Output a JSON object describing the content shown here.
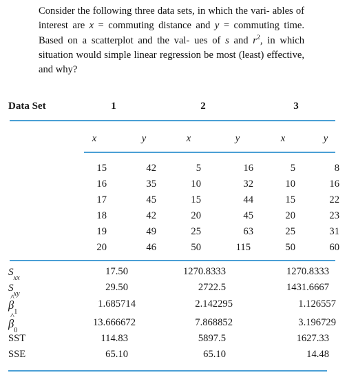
{
  "intro": {
    "line1": "Consider the following three data sets, in which the vari-",
    "line2_a": "ables  of  interest  are  ",
    "line2_x": "x",
    "line2_eq": " = commuting distance  and",
    "line3_y": "y",
    "line3_b": " = commuting time. Based on a scatterplot and the val-",
    "line4_a": "ues of ",
    "line4_s": "s",
    "line4_b": " and ",
    "line4_r": "r",
    "line4_sup": "2",
    "line4_c": ", in which situation would simple linear",
    "line5": "regression be most (least) effective, and why?",
    "full_text": "Consider the following three data sets, in which the variables of interest are x = commuting distance and y = commuting time. Based on a scatterplot and the values of s and r2, in which situation would simple linear regression be most (least) effective, and why?"
  },
  "table": {
    "corner_label": "Data Set",
    "dataset_headers": [
      "1",
      "2",
      "3"
    ],
    "column_headers": [
      "x",
      "y",
      "x",
      "y",
      "x",
      "y"
    ],
    "rows": [
      [
        "15",
        "42",
        "5",
        "16",
        "5",
        "8"
      ],
      [
        "16",
        "35",
        "10",
        "32",
        "10",
        "16"
      ],
      [
        "17",
        "45",
        "15",
        "44",
        "15",
        "22"
      ],
      [
        "18",
        "42",
        "20",
        "45",
        "20",
        "23"
      ],
      [
        "19",
        "49",
        "25",
        "63",
        "25",
        "31"
      ],
      [
        "20",
        "46",
        "50",
        "115",
        "50",
        "60"
      ]
    ],
    "stats": [
      {
        "label_type": "S",
        "sym": "S",
        "sub": "xx",
        "values": [
          "17.50",
          "1270.8333",
          "1270.8333"
        ]
      },
      {
        "label_type": "S",
        "sym": "S",
        "sub": "xy",
        "values": [
          "29.50",
          "2722.5",
          "1431.6667"
        ]
      },
      {
        "label_type": "beta",
        "sym": "β",
        "sub": "1",
        "values": [
          "1.685714",
          "2.142295",
          "1.126557"
        ]
      },
      {
        "label_type": "beta",
        "sym": "β",
        "sub": "0",
        "values": [
          "13.666672",
          "7.868852",
          "3.196729"
        ]
      },
      {
        "label_type": "plain",
        "sym": "SST",
        "sub": "",
        "values": [
          "114.83",
          "5897.5",
          "1627.33"
        ]
      },
      {
        "label_type": "plain",
        "sym": "SSE",
        "sub": "",
        "values": [
          "65.10",
          "65.10",
          "14.48"
        ]
      }
    ]
  },
  "colors": {
    "rule": "#4a9fd5",
    "text": "#1a1a1a"
  }
}
